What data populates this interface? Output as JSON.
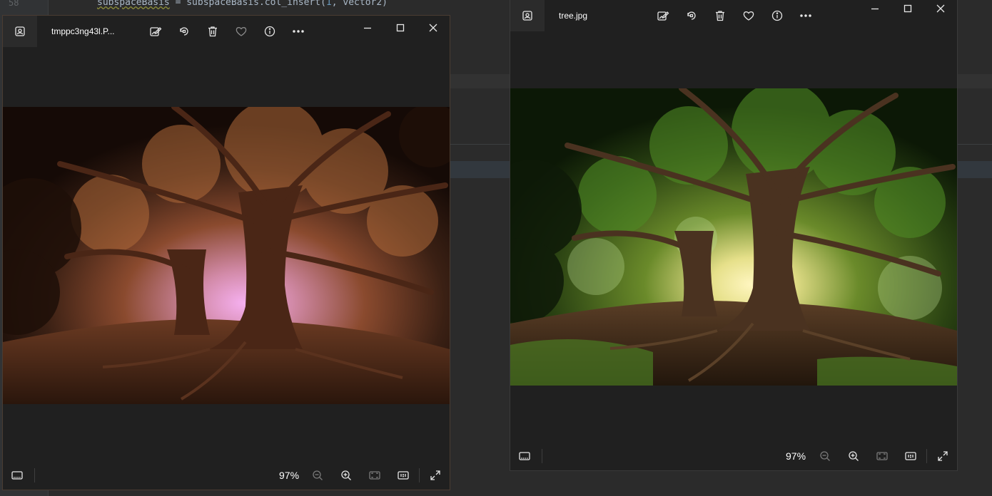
{
  "ide": {
    "line_number": "58",
    "code": {
      "var1": "subspaceBasis",
      "op": " = ",
      "var2": "subspaceBasis",
      "call": ".col_insert(",
      "arg_num": "1",
      "rest": ", vector2)"
    }
  },
  "left_window": {
    "filename": "tmppc3ng43l.P...",
    "zoom": "97%"
  },
  "right_window": {
    "filename": "tree.jpg",
    "zoom": "97%"
  },
  "icons": {
    "app": "photo-app-icon",
    "edit": "edit-image-icon",
    "rotate": "rotate-icon",
    "delete": "trash-icon",
    "favorite": "heart-icon",
    "info": "info-icon",
    "more": "more-icon",
    "minimize": "minimize-icon",
    "maximize": "maximize-icon",
    "close": "close-icon",
    "filmstrip": "filmstrip-icon",
    "zoom_out": "zoom-out-icon",
    "zoom_in": "zoom-in-icon",
    "fit": "fit-to-window-icon",
    "actual_size": "actual-size-icon",
    "fullscreen": "fullscreen-icon"
  },
  "colors": {
    "window_bg": "#202020",
    "ide_bg": "#2b2b2b",
    "text": "#ffffff"
  }
}
